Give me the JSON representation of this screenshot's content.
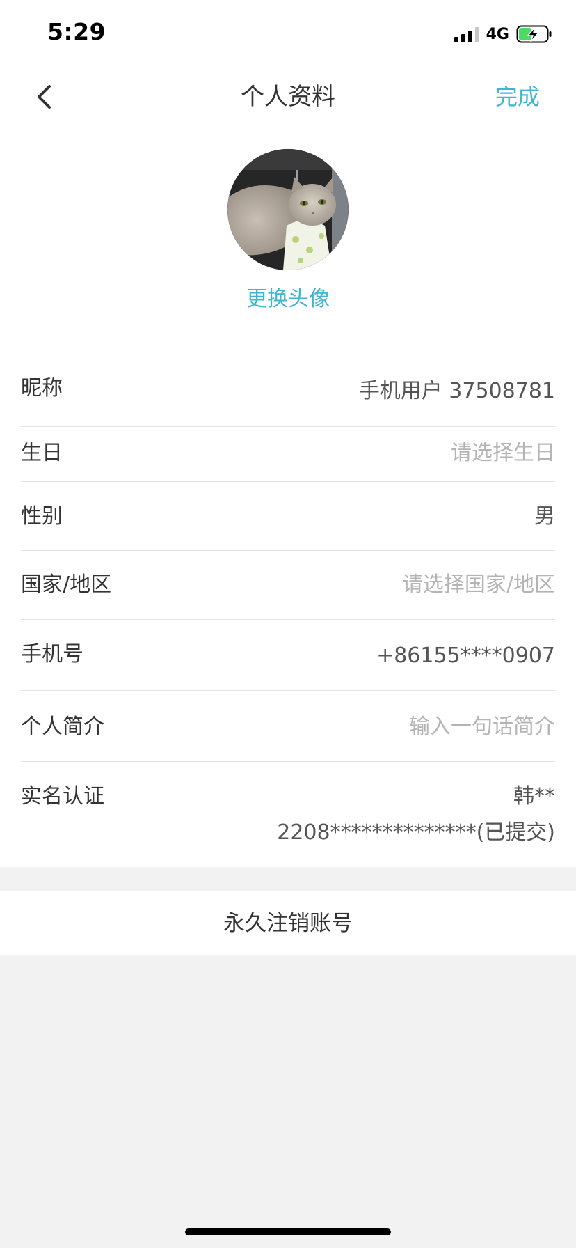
{
  "status_bar": {
    "time": "5:29",
    "network": "4G",
    "signal_icon": "signal-bars-icon",
    "battery_icon": "battery-charging-icon"
  },
  "nav": {
    "back_icon": "chevron-left-icon",
    "title": "个人资料",
    "done_label": "完成"
  },
  "profile": {
    "change_avatar_label": "更换头像"
  },
  "fields": {
    "nickname": {
      "label": "昵称",
      "value": "手机用户 37508781"
    },
    "birthday": {
      "label": "生日",
      "placeholder": "请选择生日"
    },
    "gender": {
      "label": "性别",
      "value": "男"
    },
    "region": {
      "label": "国家/地区",
      "placeholder": "请选择国家/地区"
    },
    "phone": {
      "label": "手机号",
      "value": "+86155****0907"
    },
    "bio": {
      "label": "个人简介",
      "placeholder": "输入一句话简介"
    },
    "real_name": {
      "label": "实名认证",
      "name_value": "韩**",
      "id_value": "2208**************(已提交)"
    }
  },
  "actions": {
    "cancel_account_label": "永久注销账号"
  },
  "colors": {
    "accent": "#41b4cf",
    "background": "#f2f2f2",
    "placeholder": "#b4b4b4",
    "battery_charge": "#4cd964"
  }
}
